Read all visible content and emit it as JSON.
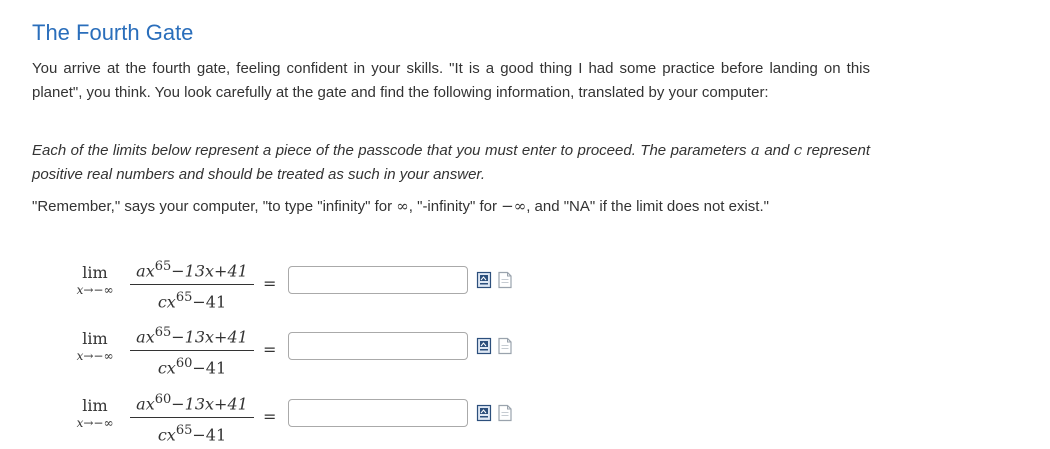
{
  "title": "The Fourth Gate",
  "intro": "You arrive at the fourth gate, feeling confident in your skills. \"It is a good thing I had some practice before landing on this planet\", you think. You look carefully at the gate and find the following information, translated by your computer:",
  "instructions": {
    "text1": "Each of the limits below represent a piece of the passcode that you must enter to proceed. The parameters",
    "var_a": "a",
    "text2": "and",
    "var_c": "c",
    "text3": "represent positive real numbers and should be treated as such in your answer."
  },
  "reminder": {
    "text1": "\"Remember,\" says your computer, \"to type \"infinity\" for",
    "inf": "∞",
    "text2": ", \"-infinity\" for",
    "neginf": "−∞",
    "text3": ", and \"NA\" if the limit does not exist.\""
  },
  "problems": [
    {
      "lim": "lim",
      "sub": "x→−∞",
      "num_coef": "ax",
      "num_exp": "65",
      "num_rest": "−13x+41",
      "den_coef": "cx",
      "den_exp": "65",
      "den_rest": "−41",
      "eq": "=",
      "answer": ""
    },
    {
      "lim": "lim",
      "sub": "x→−∞",
      "num_coef": "ax",
      "num_exp": "65",
      "num_rest": "−13x+41",
      "den_coef": "cx",
      "den_exp": "60",
      "den_rest": "−41",
      "eq": "=",
      "answer": ""
    },
    {
      "lim": "lim",
      "sub": "x→−∞",
      "num_coef": "ax",
      "num_exp": "60",
      "num_rest": "−13x+41",
      "den_coef": "cx",
      "den_exp": "65",
      "den_rest": "−41",
      "eq": "=",
      "answer": ""
    }
  ],
  "icons": {
    "preview": "preview-answer-icon",
    "help": "answer-help-icon"
  }
}
